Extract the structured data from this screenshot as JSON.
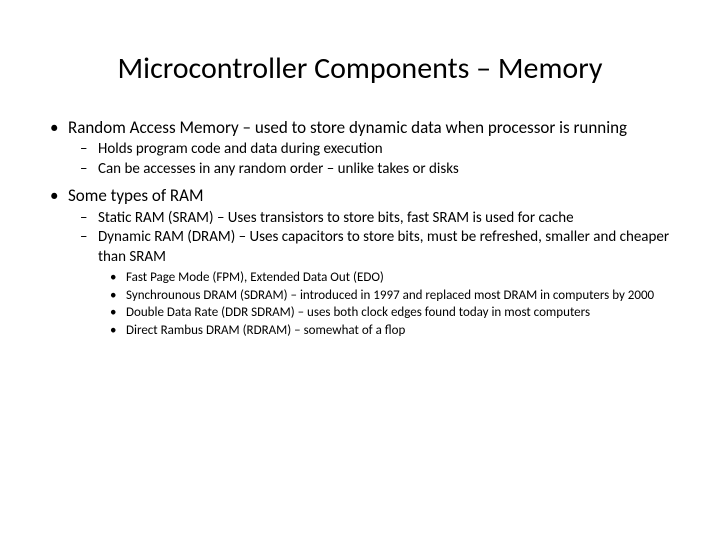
{
  "title": "Microcontroller Components – Memory",
  "bullets": [
    {
      "text": "Random Access Memory – used to store dynamic data when processor is running",
      "sub": [
        {
          "text": "Holds program code and data during execution"
        },
        {
          "text": "Can be accesses in any random order – unlike takes or disks"
        }
      ]
    },
    {
      "text": "Some types of RAM",
      "sub": [
        {
          "text": "Static RAM (SRAM) – Uses transistors to store bits, fast SRAM is used for cache"
        },
        {
          "text": "Dynamic RAM (DRAM) – Uses capacitors to store bits, must be refreshed, smaller and cheaper than SRAM",
          "sub": [
            {
              "text": "Fast Page Mode (FPM), Extended Data Out (EDO)"
            },
            {
              "text": "Synchrounous DRAM (SDRAM) – introduced in 1997 and replaced most DRAM in computers by 2000"
            },
            {
              "text": "Double Data Rate (DDR SDRAM) – uses both clock edges found today in most computers"
            },
            {
              "text": "Direct Rambus DRAM (RDRAM) – somewhat of a flop"
            }
          ]
        }
      ]
    }
  ]
}
